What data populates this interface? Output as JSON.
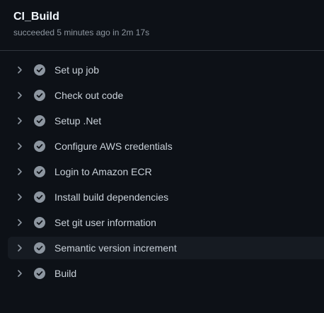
{
  "job": {
    "title": "CI_Build",
    "status": "succeeded 5 minutes ago in 2m 17s"
  },
  "steps": [
    {
      "label": "Set up job",
      "status": "success"
    },
    {
      "label": "Check out code",
      "status": "success"
    },
    {
      "label": "Setup .Net",
      "status": "success"
    },
    {
      "label": "Configure AWS credentials",
      "status": "success"
    },
    {
      "label": "Login to Amazon ECR",
      "status": "success"
    },
    {
      "label": "Install build dependencies",
      "status": "success"
    },
    {
      "label": "Set git user information",
      "status": "success"
    },
    {
      "label": "Semantic version increment",
      "status": "success",
      "highlighted": true
    },
    {
      "label": "Build",
      "status": "success"
    }
  ],
  "icons": {
    "expand": "chevron-right-icon",
    "status": "check-circle-icon"
  },
  "colors": {
    "background": "#0d1117",
    "divider": "#30363d",
    "check_fill": "#8d96a0",
    "highlight_row": "#161b22"
  }
}
